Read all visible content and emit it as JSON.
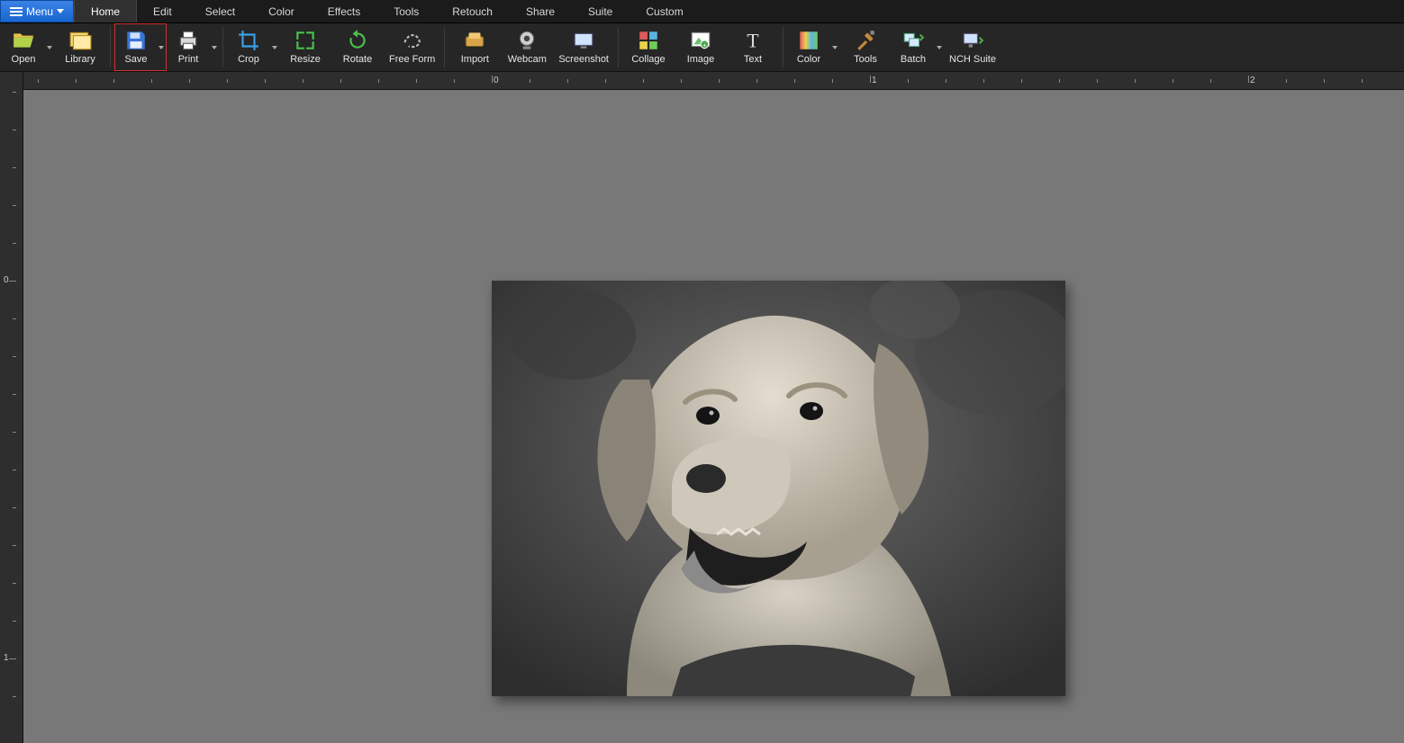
{
  "menu": {
    "label": "Menu"
  },
  "tabs": [
    {
      "label": "Home",
      "active": true
    },
    {
      "label": "Edit",
      "active": false
    },
    {
      "label": "Select",
      "active": false
    },
    {
      "label": "Color",
      "active": false
    },
    {
      "label": "Effects",
      "active": false
    },
    {
      "label": "Tools",
      "active": false
    },
    {
      "label": "Retouch",
      "active": false
    },
    {
      "label": "Share",
      "active": false
    },
    {
      "label": "Suite",
      "active": false
    },
    {
      "label": "Custom",
      "active": false
    }
  ],
  "ribbon": {
    "open": "Open",
    "library": "Library",
    "save": "Save",
    "print": "Print",
    "crop": "Crop",
    "resize": "Resize",
    "rotate": "Rotate",
    "freeform": "Free Form",
    "import": "Import",
    "webcam": "Webcam",
    "screenshot": "Screenshot",
    "collage": "Collage",
    "image": "Image",
    "text": "Text",
    "color": "Color",
    "tools": "Tools",
    "batch": "Batch",
    "nchsuite": "NCH Suite"
  },
  "ruler": {
    "h": [
      "0",
      "1",
      "2"
    ],
    "v": [
      "0",
      "1"
    ]
  },
  "highlighted_button": "save",
  "canvas": {
    "image_description": "grayscale-dog-photo"
  }
}
